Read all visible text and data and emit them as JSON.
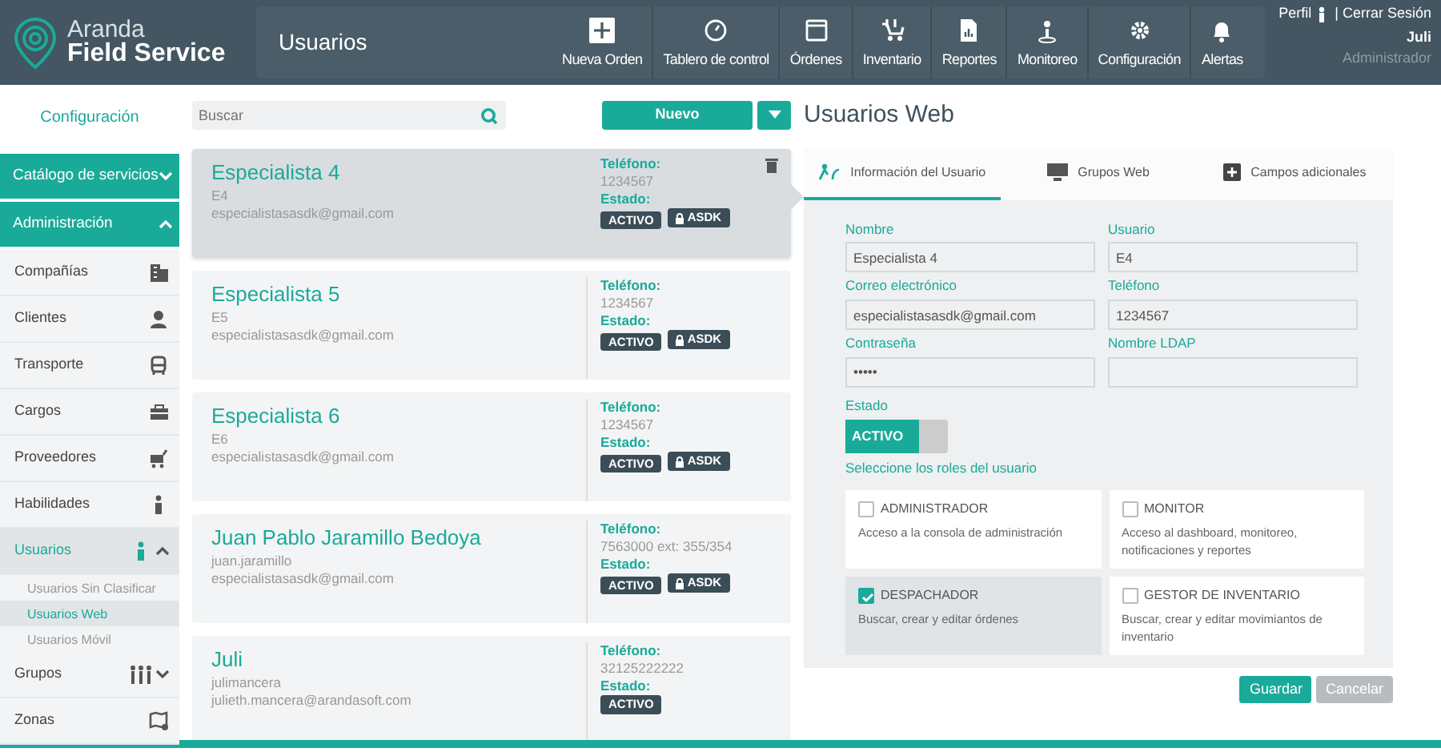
{
  "header": {
    "brand_top": "Aranda",
    "brand_bottom": "Field Service",
    "page_title": "Usuarios",
    "nav": [
      {
        "label": "Nueva Orden",
        "kind": "new"
      },
      {
        "label": "Tablero de control",
        "kind": "nav"
      },
      {
        "label": "Órdenes",
        "kind": "nav"
      },
      {
        "label": "Inventario",
        "kind": "nav"
      },
      {
        "label": "Reportes",
        "kind": "nav"
      },
      {
        "label": "Monitoreo",
        "kind": "nav"
      },
      {
        "label": "Configuración",
        "kind": "nav"
      },
      {
        "label": "Alertas",
        "kind": "nav"
      }
    ],
    "profile": "Perfil",
    "separator": "|",
    "logout": "Cerrar Sesión",
    "user_name": "Juli",
    "user_role": "Administrador"
  },
  "sidebar": {
    "title": "Configuración",
    "sections": [
      {
        "label": "Catálogo de servicios",
        "expanded": false
      },
      {
        "label": "Administración",
        "expanded": true,
        "items": [
          {
            "label": "Compañías",
            "selected": false
          },
          {
            "label": "Clientes",
            "selected": false
          },
          {
            "label": "Transporte",
            "selected": false
          },
          {
            "label": "Cargos",
            "selected": false
          },
          {
            "label": "Proveedores",
            "selected": false
          },
          {
            "label": "Habilidades",
            "selected": false
          },
          {
            "label": "Usuarios",
            "selected": true,
            "expanded": true,
            "children": [
              {
                "label": "Usuarios Sin Clasificar",
                "selected": false
              },
              {
                "label": "Usuarios Web",
                "selected": true
              },
              {
                "label": "Usuarios Móvil",
                "selected": false
              }
            ]
          },
          {
            "label": "Grupos",
            "selected": false,
            "expanded": false
          },
          {
            "label": "Zonas",
            "selected": false
          }
        ]
      }
    ]
  },
  "search": {
    "placeholder": "Buscar"
  },
  "new_button": "Nuevo",
  "users": [
    {
      "name": "Especialista 4",
      "login": "E4",
      "email": "especialistasasdk@gmail.com",
      "phone_label": "Teléfono:",
      "phone": "1234567",
      "state_label": "Estado:",
      "selected": true,
      "badges": [
        {
          "kind": "status",
          "text": "ACTIVO"
        },
        {
          "kind": "lock",
          "text": "ASDK"
        }
      ]
    },
    {
      "name": "Especialista 5",
      "login": "E5",
      "email": "especialistasasdk@gmail.com",
      "phone_label": "Teléfono:",
      "phone": "1234567",
      "state_label": "Estado:",
      "selected": false,
      "badges": [
        {
          "kind": "status",
          "text": "ACTIVO"
        },
        {
          "kind": "lock",
          "text": "ASDK"
        }
      ]
    },
    {
      "name": "Especialista 6",
      "login": "E6",
      "email": "especialistasasdk@gmail.com",
      "phone_label": "Teléfono:",
      "phone": "1234567",
      "state_label": "Estado:",
      "selected": false,
      "badges": [
        {
          "kind": "status",
          "text": "ACTIVO"
        },
        {
          "kind": "lock",
          "text": "ASDK"
        }
      ]
    },
    {
      "name": "Juan Pablo Jaramillo Bedoya",
      "login": "juan.jaramillo",
      "email": "especialistasasdk@gmail.com",
      "phone_label": "Teléfono:",
      "phone": "7563000 ext: 355/354",
      "state_label": "Estado:",
      "selected": false,
      "badges": [
        {
          "kind": "status",
          "text": "ACTIVO"
        },
        {
          "kind": "lock",
          "text": "ASDK"
        }
      ]
    },
    {
      "name": "Juli",
      "login": "julimancera",
      "email": "julieth.mancera@arandasoft.com",
      "phone_label": "Teléfono:",
      "phone": "32125222222",
      "state_label": "Estado:",
      "selected": false,
      "badges": [
        {
          "kind": "status",
          "text": "ACTIVO"
        }
      ]
    }
  ],
  "detail": {
    "title": "Usuarios Web",
    "tabs": [
      {
        "label": "Información del Usuario",
        "selected": true
      },
      {
        "label": "Grupos Web",
        "selected": false
      },
      {
        "label": "Campos adicionales",
        "selected": false
      }
    ],
    "fields": [
      {
        "label": "Nombre",
        "value": "Especialista 4"
      },
      {
        "label": "Usuario",
        "value": "E4"
      },
      {
        "label": "Correo electrónico",
        "value": "especialistasasdk@gmail.com"
      },
      {
        "label": "Teléfono",
        "value": "1234567"
      },
      {
        "label": "Contraseña",
        "value": "•••••"
      },
      {
        "label": "Nombre LDAP"
      }
    ],
    "state_label": "Estado",
    "state_toggle": {
      "label": "ACTIVO",
      "on": true
    },
    "roles_label": "Seleccione los roles del usuario",
    "roles": [
      {
        "name": "ADMINISTRADOR",
        "description": "Acceso a la consola de administración",
        "checked": false
      },
      {
        "name": "MONITOR",
        "description": "Acceso al dashboard, monitoreo, notificaciones y reportes",
        "checked": false
      },
      {
        "name": "DESPACHADOR",
        "description": "Buscar, crear y editar órdenes",
        "checked": true
      },
      {
        "name": "GESTOR DE INVENTARIO",
        "description": "Buscar, crear y editar movimiantos de inventario",
        "checked": false
      }
    ],
    "buttons": [
      {
        "label": "Guardar",
        "kind": "primary"
      },
      {
        "label": "Cancelar",
        "kind": "secondary"
      }
    ]
  }
}
